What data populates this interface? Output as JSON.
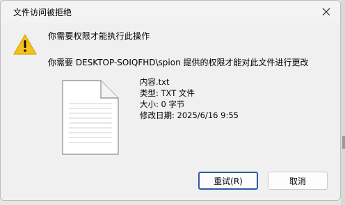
{
  "window": {
    "title": "文件访问被拒绝"
  },
  "message": {
    "main": "你需要权限才能执行此操作",
    "sub": "你需要 DESKTOP-SOIQFHD\\spion 提供的权限才能对此文件进行更改"
  },
  "file": {
    "name": "内容.txt",
    "type": "类型: TXT 文件",
    "size": "大小: 0 字节",
    "modified": "修改日期: 2025/6/16 9:55"
  },
  "buttons": {
    "retry": "重试(R)",
    "cancel": "取消"
  },
  "icons": {
    "warning": "warning-icon",
    "close": "close-icon",
    "document": "document-icon"
  },
  "colors": {
    "warning_fill": "#f5c11c",
    "accent_border": "#2b5aa6"
  }
}
